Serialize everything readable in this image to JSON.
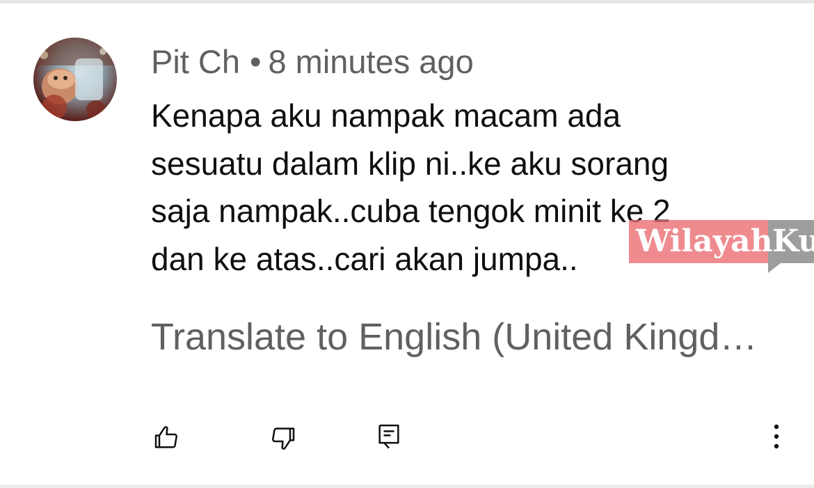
{
  "comment": {
    "author": "Pit Ch",
    "separator": "•",
    "timestamp": "8 minutes ago",
    "lines": [
      "Kenapa aku nampak macam ada",
      "sesuatu dalam klip ni..ke aku sorang",
      "saja nampak..cuba tengok minit ke 2",
      "dan ke atas..cari akan jumpa.."
    ],
    "translate_label": "Translate to English (United Kingd…"
  },
  "actions": {
    "like_icon": "thumbs-up-icon",
    "dislike_icon": "thumbs-down-icon",
    "reply_icon": "reply-comment-icon",
    "more_icon": "more-vertical-icon"
  },
  "watermark": {
    "text_a": "Wilayah",
    "text_b": "Ku"
  },
  "colors": {
    "text_primary": "#0f0f0f",
    "text_secondary": "#606060",
    "watermark_red": "#eb6e73",
    "watermark_grey": "#8c8c8c"
  }
}
